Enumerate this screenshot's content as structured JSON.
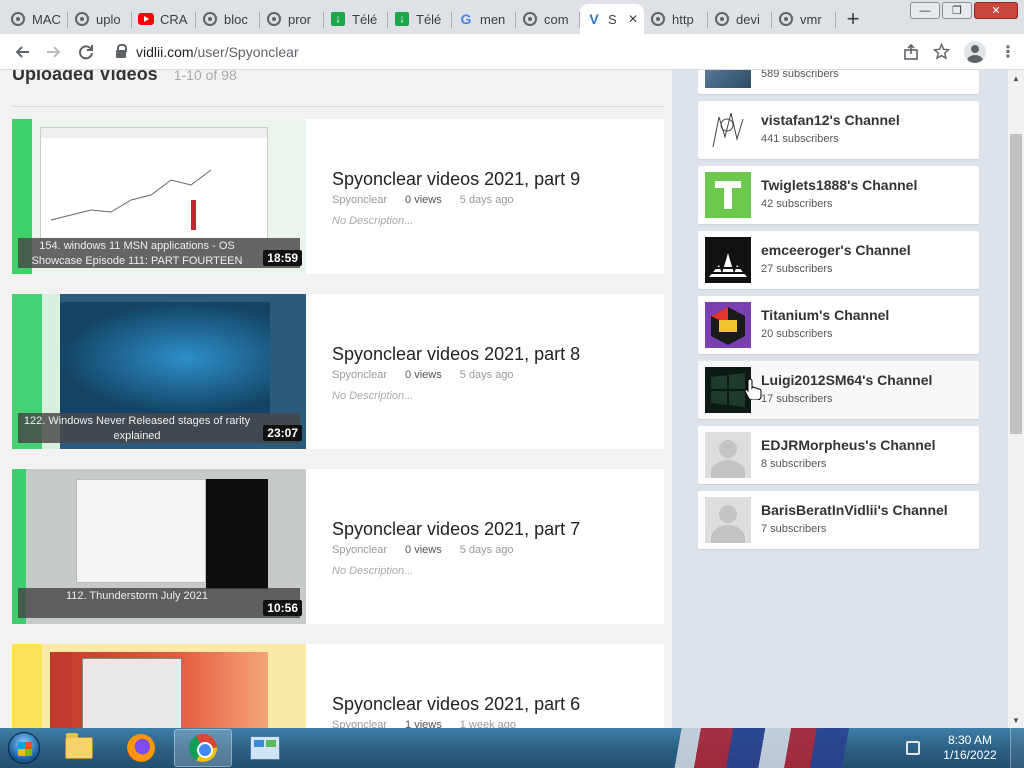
{
  "browser": {
    "tabs": [
      {
        "title": "MAC",
        "icon": "globe-icon"
      },
      {
        "title": "uplo",
        "icon": "globe-icon"
      },
      {
        "title": "CRA",
        "icon": "youtube-icon"
      },
      {
        "title": "bloc",
        "icon": "globe-icon"
      },
      {
        "title": "pror",
        "icon": "globe-icon"
      },
      {
        "title": "Télé",
        "icon": "download-icon"
      },
      {
        "title": "Télé",
        "icon": "download-icon"
      },
      {
        "title": "men",
        "icon": "google-icon"
      },
      {
        "title": "com",
        "icon": "globe-icon"
      },
      {
        "title": "S",
        "icon": "vidlii-icon",
        "active": true
      },
      {
        "title": "http",
        "icon": "globe-icon"
      },
      {
        "title": "devi",
        "icon": "globe-icon"
      },
      {
        "title": "vmr",
        "icon": "globe-icon"
      }
    ],
    "new_tab": "+",
    "window_controls": {
      "minimize": "—",
      "maximize": "❐",
      "close": "✕"
    },
    "url_host": "vidlii.com",
    "url_path": "/user/Spyonclear"
  },
  "uploaded": {
    "title": "Uploaded Videos",
    "count": "1-10 of 98",
    "videos": [
      {
        "title": "Spyonclear videos 2021, part 9",
        "author": "Spyonclear",
        "views": "0 views",
        "age": "5 days ago",
        "desc": "No Description...",
        "thumb_caption": "154. windows 11 MSN applications - OS Showcase Episode 111: PART FOURTEEN",
        "duration": "18:59"
      },
      {
        "title": "Spyonclear videos 2021, part 8",
        "author": "Spyonclear",
        "views": "0 views",
        "age": "5 days ago",
        "desc": "No Description...",
        "thumb_caption": "122. Windows Never Released stages of rarity explained",
        "duration": "23:07"
      },
      {
        "title": "Spyonclear videos 2021, part 7",
        "author": "Spyonclear",
        "views": "0 views",
        "age": "5 days ago",
        "desc": "No Description...",
        "thumb_caption": "112. Thunderstorm July 2021",
        "duration": "10:56"
      },
      {
        "title": "Spyonclear videos 2021, part 6",
        "author": "Spyonclear",
        "views": "1 views",
        "age": "1 week ago",
        "desc": "",
        "thumb_caption": "",
        "duration": ""
      }
    ]
  },
  "channels": [
    {
      "name": "",
      "subs": "589 subscribers"
    },
    {
      "name": "vistafan12's Channel",
      "subs": "441 subscribers"
    },
    {
      "name": "Twiglets1888's Channel",
      "subs": "42 subscribers"
    },
    {
      "name": "emceeroger's Channel",
      "subs": "27 subscribers"
    },
    {
      "name": "Titanium's Channel",
      "subs": "20 subscribers"
    },
    {
      "name": "Luigi2012SM64's Channel",
      "subs": "17 subscribers"
    },
    {
      "name": "EDJRMorpheus's Channel",
      "subs": "8 subscribers"
    },
    {
      "name": "BarisBeratInVidlii's Channel",
      "subs": "7 subscribers"
    }
  ],
  "taskbar": {
    "time": "8:30 AM",
    "date": "1/16/2022"
  }
}
